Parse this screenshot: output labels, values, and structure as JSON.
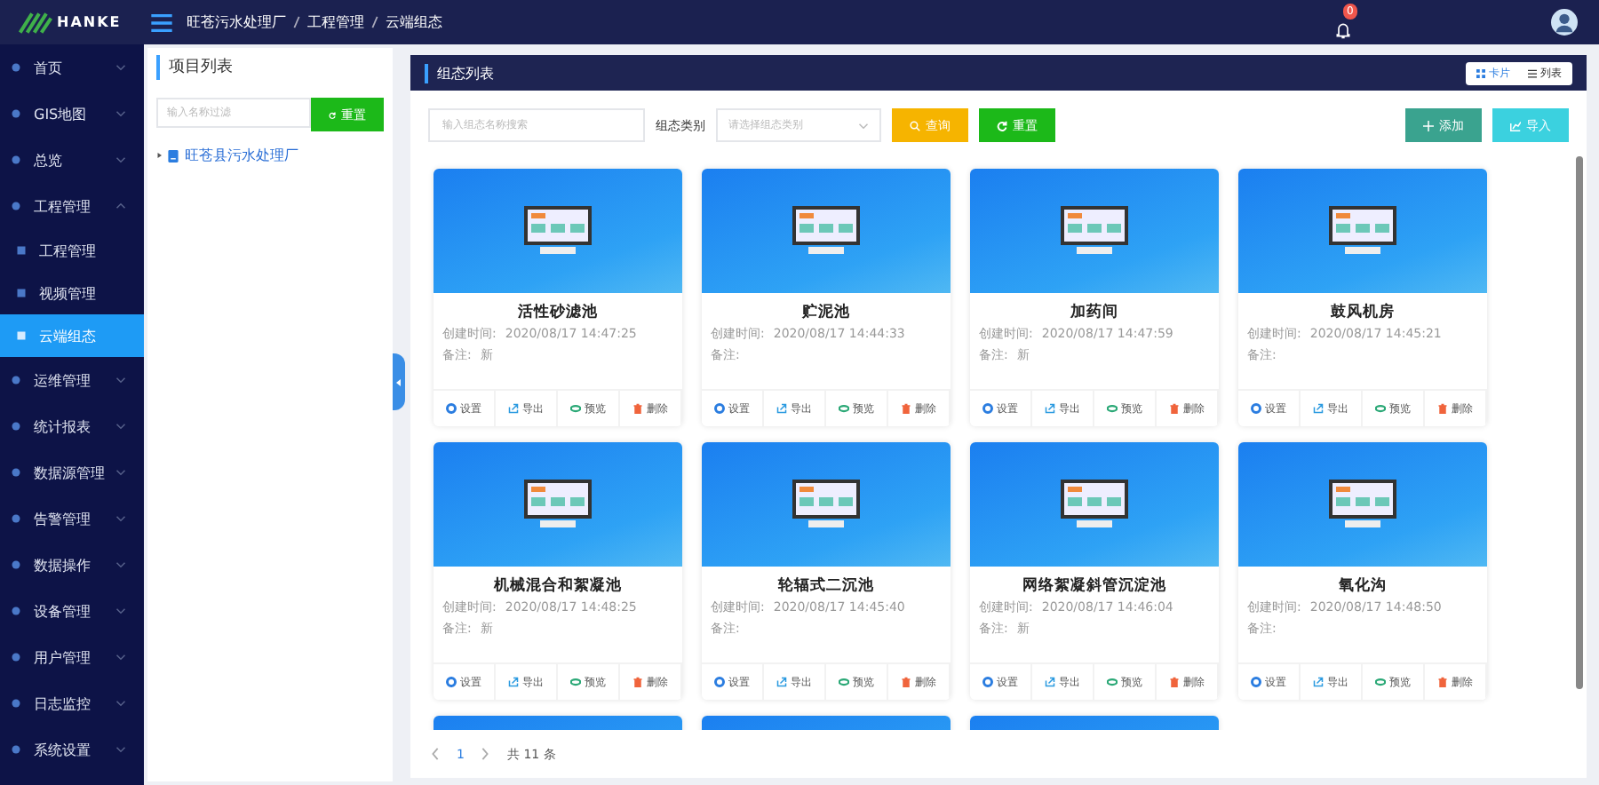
{
  "header": {
    "logo_text": "HANKE",
    "breadcrumb": [
      "旺苍污水处理厂",
      "工程管理",
      "云端组态"
    ],
    "notification_count": "0"
  },
  "sidebar": {
    "items": [
      {
        "label": "首页",
        "expanded": false,
        "selected": false
      },
      {
        "label": "GIS地图",
        "expanded": false,
        "selected": false
      },
      {
        "label": "总览",
        "expanded": false,
        "selected": false
      },
      {
        "label": "工程管理",
        "expanded": true,
        "selected": false,
        "children": [
          {
            "label": "工程管理",
            "selected": false
          },
          {
            "label": "视频管理",
            "selected": false
          },
          {
            "label": "云端组态",
            "selected": true
          }
        ]
      },
      {
        "label": "运维管理",
        "expanded": false,
        "selected": false
      },
      {
        "label": "统计报表",
        "expanded": false,
        "selected": false
      },
      {
        "label": "数据源管理",
        "expanded": false,
        "selected": false
      },
      {
        "label": "告警管理",
        "expanded": false,
        "selected": false
      },
      {
        "label": "数据操作",
        "expanded": false,
        "selected": false
      },
      {
        "label": "设备管理",
        "expanded": false,
        "selected": false
      },
      {
        "label": "用户管理",
        "expanded": false,
        "selected": false
      },
      {
        "label": "日志监控",
        "expanded": false,
        "selected": false
      },
      {
        "label": "系统设置",
        "expanded": false,
        "selected": false
      }
    ]
  },
  "project_panel": {
    "title": "项目列表",
    "filter": {
      "placeholder": "输入名称过滤"
    },
    "reset_button": "重置",
    "tree": [
      {
        "label": "旺苍县污水处理厂",
        "expanded": false
      }
    ]
  },
  "main": {
    "title": "组态列表",
    "view_toggle": [
      {
        "label": "卡片",
        "kind": "grid",
        "selected": true
      },
      {
        "label": "列表",
        "kind": "list",
        "selected": false
      }
    ],
    "search": {
      "placeholder": "输入组态名称搜索"
    },
    "category_label": "组态类别",
    "category": {
      "placeholder": "请选择组态类别"
    },
    "buttons": {
      "query": "查询",
      "reset": "重置",
      "add": "添加",
      "import": "导入"
    },
    "cards": [
      {
        "name": "活性砂滤池",
        "created_label": "创建时间:",
        "created": "2020/08/17 14:47:25",
        "note_label": "备注:",
        "note": "新",
        "actions": [
          {
            "kind": "gear",
            "label": "设置"
          },
          {
            "kind": "export",
            "label": "导出"
          },
          {
            "kind": "eye",
            "label": "预览"
          },
          {
            "kind": "trash",
            "label": "删除"
          }
        ]
      },
      {
        "name": "贮泥池",
        "created_label": "创建时间:",
        "created": "2020/08/17 14:44:33",
        "note_label": "备注:",
        "actions": [
          {
            "kind": "gear",
            "label": "设置"
          },
          {
            "kind": "export",
            "label": "导出"
          },
          {
            "kind": "eye",
            "label": "预览"
          },
          {
            "kind": "trash",
            "label": "删除"
          }
        ]
      },
      {
        "name": "加药间",
        "created_label": "创建时间:",
        "created": "2020/08/17 14:47:59",
        "note_label": "备注:",
        "note": "新",
        "actions": [
          {
            "kind": "gear",
            "label": "设置"
          },
          {
            "kind": "export",
            "label": "导出"
          },
          {
            "kind": "eye",
            "label": "预览"
          },
          {
            "kind": "trash",
            "label": "删除"
          }
        ]
      },
      {
        "name": "鼓风机房",
        "created_label": "创建时间:",
        "created": "2020/08/17 14:45:21",
        "note_label": "备注:",
        "actions": [
          {
            "kind": "gear",
            "label": "设置"
          },
          {
            "kind": "export",
            "label": "导出"
          },
          {
            "kind": "eye",
            "label": "预览"
          },
          {
            "kind": "trash",
            "label": "删除"
          }
        ]
      },
      {
        "name": "机械混合和絮凝池",
        "created_label": "创建时间:",
        "created": "2020/08/17 14:48:25",
        "note_label": "备注:",
        "note": "新",
        "actions": [
          {
            "kind": "gear",
            "label": "设置"
          },
          {
            "kind": "export",
            "label": "导出"
          },
          {
            "kind": "eye",
            "label": "预览"
          },
          {
            "kind": "trash",
            "label": "删除"
          }
        ]
      },
      {
        "name": "轮辐式二沉池",
        "created_label": "创建时间:",
        "created": "2020/08/17 14:45:40",
        "note_label": "备注:",
        "actions": [
          {
            "kind": "gear",
            "label": "设置"
          },
          {
            "kind": "export",
            "label": "导出"
          },
          {
            "kind": "eye",
            "label": "预览"
          },
          {
            "kind": "trash",
            "label": "删除"
          }
        ]
      },
      {
        "name": "网络絮凝斜管沉淀池",
        "created_label": "创建时间:",
        "created": "2020/08/17 14:46:04",
        "note_label": "备注:",
        "note": "新",
        "actions": [
          {
            "kind": "gear",
            "label": "设置"
          },
          {
            "kind": "export",
            "label": "导出"
          },
          {
            "kind": "eye",
            "label": "预览"
          },
          {
            "kind": "trash",
            "label": "删除"
          }
        ]
      },
      {
        "name": "氧化沟",
        "created_label": "创建时间:",
        "created": "2020/08/17 14:48:50",
        "note_label": "备注:",
        "actions": [
          {
            "kind": "gear",
            "label": "设置"
          },
          {
            "kind": "export",
            "label": "导出"
          },
          {
            "kind": "eye",
            "label": "预览"
          },
          {
            "kind": "trash",
            "label": "删除"
          }
        ]
      }
    ],
    "cut_off_cards": [
      {
        "kind": "preview"
      },
      {
        "kind": "preview"
      },
      {
        "kind": "preview"
      }
    ],
    "pagination": {
      "pages": [
        {
          "label": "1",
          "selected": true
        }
      ],
      "total": "共 11 条"
    }
  }
}
